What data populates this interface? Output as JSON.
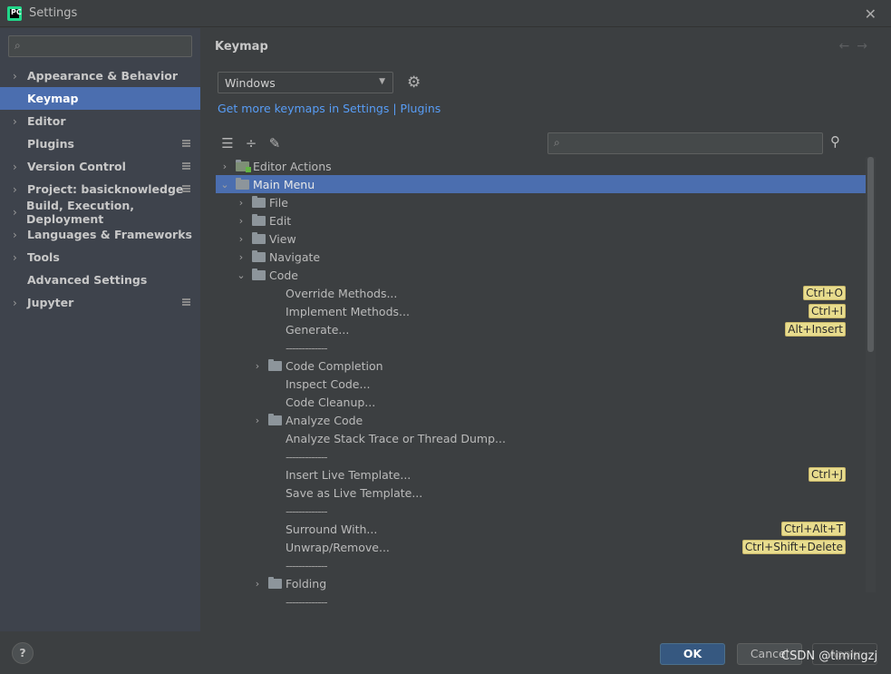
{
  "window": {
    "title": "Settings",
    "close_icon": "close-icon"
  },
  "sidebar": {
    "search_placeholder": "",
    "items": [
      {
        "label": "Appearance & Behavior",
        "expandable": true,
        "badge": false,
        "selected": false
      },
      {
        "label": "Keymap",
        "expandable": false,
        "badge": false,
        "selected": true
      },
      {
        "label": "Editor",
        "expandable": true,
        "badge": false,
        "selected": false
      },
      {
        "label": "Plugins",
        "expandable": false,
        "badge": true,
        "selected": false
      },
      {
        "label": "Version Control",
        "expandable": true,
        "badge": true,
        "selected": false
      },
      {
        "label": "Project: basicknowledge",
        "expandable": true,
        "badge": true,
        "selected": false
      },
      {
        "label": "Build, Execution, Deployment",
        "expandable": true,
        "badge": false,
        "selected": false
      },
      {
        "label": "Languages & Frameworks",
        "expandable": true,
        "badge": false,
        "selected": false
      },
      {
        "label": "Tools",
        "expandable": true,
        "badge": false,
        "selected": false
      },
      {
        "label": "Advanced Settings",
        "expandable": false,
        "badge": false,
        "selected": false
      },
      {
        "label": "Jupyter",
        "expandable": true,
        "badge": true,
        "selected": false
      }
    ]
  },
  "main": {
    "title": "Keymap",
    "keymap_select": {
      "value": "Windows"
    },
    "get_more_link": "Get more keymaps in Settings | Plugins",
    "tree_search_placeholder": "",
    "tree": [
      {
        "label": "Editor Actions",
        "level": 0,
        "chevron": "right",
        "folder": "green",
        "shortcut": null,
        "selected": false
      },
      {
        "label": "Main Menu",
        "level": 0,
        "chevron": "down",
        "folder": "menu",
        "shortcut": null,
        "selected": true
      },
      {
        "label": "File",
        "level": 1,
        "chevron": "right",
        "folder": "plain",
        "shortcut": null,
        "selected": false
      },
      {
        "label": "Edit",
        "level": 1,
        "chevron": "right",
        "folder": "plain",
        "shortcut": null,
        "selected": false
      },
      {
        "label": "View",
        "level": 1,
        "chevron": "right",
        "folder": "plain",
        "shortcut": null,
        "selected": false
      },
      {
        "label": "Navigate",
        "level": 1,
        "chevron": "right",
        "folder": "plain",
        "shortcut": null,
        "selected": false
      },
      {
        "label": "Code",
        "level": 1,
        "chevron": "down",
        "folder": "plain",
        "shortcut": null,
        "selected": false
      },
      {
        "label": "Override Methods...",
        "level": 2,
        "chevron": null,
        "folder": null,
        "shortcut": "Ctrl+O",
        "selected": false
      },
      {
        "label": "Implement Methods...",
        "level": 2,
        "chevron": null,
        "folder": null,
        "shortcut": "Ctrl+I",
        "selected": false
      },
      {
        "label": "Generate...",
        "level": 2,
        "chevron": null,
        "folder": null,
        "shortcut": "Alt+Insert",
        "selected": false
      },
      {
        "label": "-------------",
        "level": 2,
        "chevron": null,
        "folder": null,
        "shortcut": null,
        "selected": false,
        "separator": true
      },
      {
        "label": "Code Completion",
        "level": 2,
        "chevron": "right",
        "folder": "plain",
        "shortcut": null,
        "selected": false
      },
      {
        "label": "Inspect Code...",
        "level": 2,
        "chevron": null,
        "folder": null,
        "shortcut": null,
        "selected": false
      },
      {
        "label": "Code Cleanup...",
        "level": 2,
        "chevron": null,
        "folder": null,
        "shortcut": null,
        "selected": false
      },
      {
        "label": "Analyze Code",
        "level": 2,
        "chevron": "right",
        "folder": "plain",
        "shortcut": null,
        "selected": false
      },
      {
        "label": "Analyze Stack Trace or Thread Dump...",
        "level": 2,
        "chevron": null,
        "folder": null,
        "shortcut": null,
        "selected": false
      },
      {
        "label": "-------------",
        "level": 2,
        "chevron": null,
        "folder": null,
        "shortcut": null,
        "selected": false,
        "separator": true
      },
      {
        "label": "Insert Live Template...",
        "level": 2,
        "chevron": null,
        "folder": null,
        "shortcut": "Ctrl+J",
        "selected": false
      },
      {
        "label": "Save as Live Template...",
        "level": 2,
        "chevron": null,
        "folder": null,
        "shortcut": null,
        "selected": false
      },
      {
        "label": "-------------",
        "level": 2,
        "chevron": null,
        "folder": null,
        "shortcut": null,
        "selected": false,
        "separator": true
      },
      {
        "label": "Surround With...",
        "level": 2,
        "chevron": null,
        "folder": null,
        "shortcut": "Ctrl+Alt+T",
        "selected": false
      },
      {
        "label": "Unwrap/Remove...",
        "level": 2,
        "chevron": null,
        "folder": null,
        "shortcut": "Ctrl+Shift+Delete",
        "selected": false
      },
      {
        "label": "-------------",
        "level": 2,
        "chevron": null,
        "folder": null,
        "shortcut": null,
        "selected": false,
        "separator": true
      },
      {
        "label": "Folding",
        "level": 2,
        "chevron": "right",
        "folder": "plain",
        "shortcut": null,
        "selected": false
      },
      {
        "label": "-------------",
        "level": 2,
        "chevron": null,
        "folder": null,
        "shortcut": null,
        "selected": false,
        "separator": true
      }
    ]
  },
  "footer": {
    "help_label": "?",
    "ok_label": "OK",
    "cancel_label": "Cancel",
    "apply_label": "Apply",
    "watermark": "CSDN @timingzj"
  },
  "colors": {
    "selection": "#4b6eaf",
    "link": "#589df6",
    "shortcut_bg": "#e8dc8d",
    "ok_button": "#365880"
  }
}
